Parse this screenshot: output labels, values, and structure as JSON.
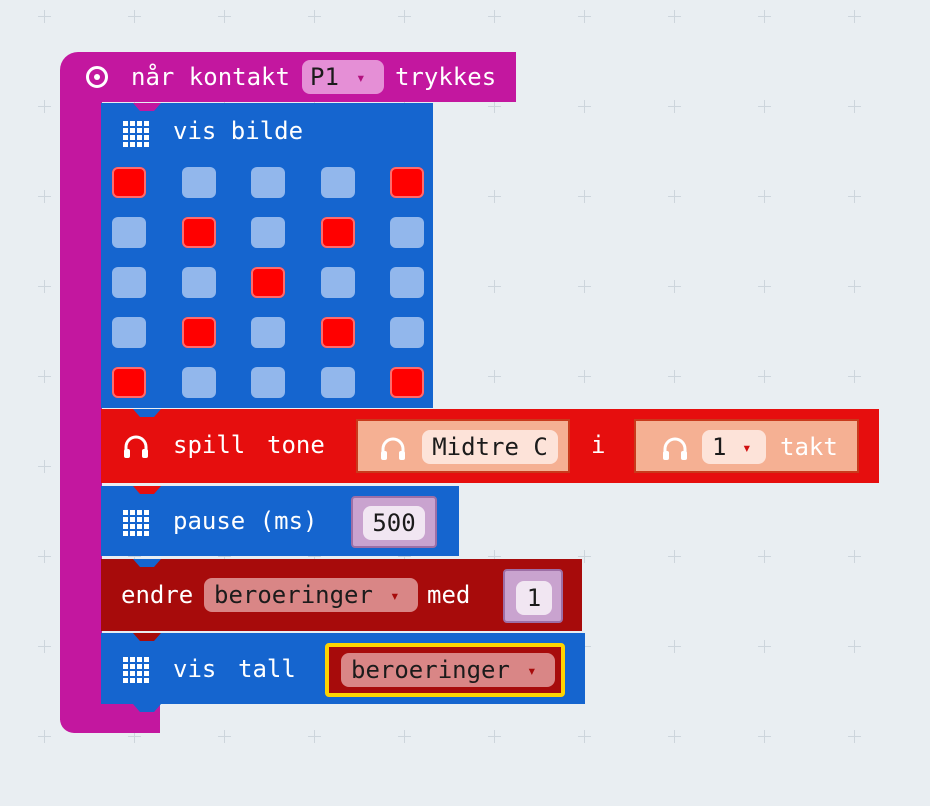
{
  "colors": {
    "event": "#c3179f",
    "basic": "#1565cf",
    "music": "#e60e0e",
    "variables": "#a70b0b",
    "selected_outline": "#ffd400",
    "led_on": "#ff0000",
    "led_off": "#92b7ec"
  },
  "icons": {
    "event": "target-icon",
    "basic": "led-grid-icon",
    "music": "headphones-icon",
    "dropdown": "dropdown-triangle-icon"
  },
  "event_block": {
    "prefix": "når kontakt",
    "pin": "P1",
    "suffix": "trykkes"
  },
  "show_image": {
    "label": "vis bilde",
    "leds": [
      [
        1,
        0,
        0,
        0,
        1
      ],
      [
        0,
        1,
        0,
        1,
        0
      ],
      [
        0,
        0,
        1,
        0,
        0
      ],
      [
        0,
        1,
        0,
        1,
        0
      ],
      [
        1,
        0,
        0,
        0,
        1
      ]
    ]
  },
  "play_tone": {
    "label_a": "spill",
    "label_b": "tone",
    "note": "Midtre C",
    "sep": "i",
    "beats": "1",
    "unit": "takt"
  },
  "pause": {
    "label": "pause (ms)",
    "value": "500"
  },
  "change_var": {
    "label": "endre",
    "variable": "beroeringer",
    "by": "med",
    "value": "1"
  },
  "show_number": {
    "label_a": "vis",
    "label_b": "tall",
    "variable": "beroeringer"
  },
  "dropdown_glyph": "▾"
}
